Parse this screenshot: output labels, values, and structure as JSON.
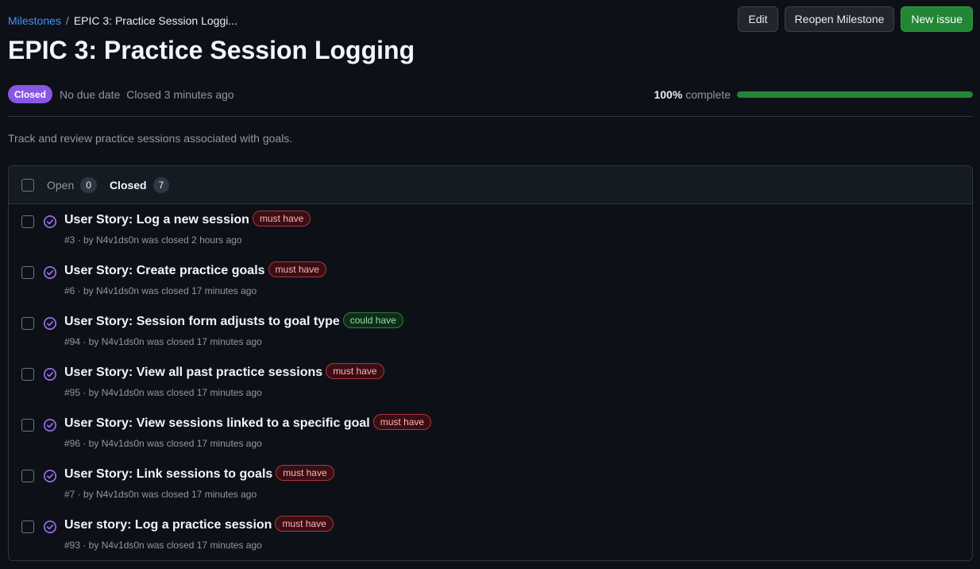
{
  "breadcrumb": {
    "root": "Milestones",
    "separator": "/",
    "current": "EPIC 3: Practice Session Loggi..."
  },
  "actions": {
    "edit": "Edit",
    "reopen": "Reopen Milestone",
    "new_issue": "New issue"
  },
  "milestone": {
    "title": "EPIC 3: Practice Session Logging",
    "state": "Closed",
    "due": "No due date",
    "closed_time": "Closed 3 minutes ago",
    "percent_label": "100%",
    "complete_word": "complete",
    "progress_fraction": 1.0,
    "description": "Track and review practice sessions associated with goals."
  },
  "filters": {
    "open_label": "Open",
    "open_count": "0",
    "closed_label": "Closed",
    "closed_count": "7"
  },
  "colors": {
    "accent_link": "#4493f8",
    "closed_purple": "#8957e5",
    "progress_green": "#238636"
  },
  "issues": [
    {
      "title": "User Story: Log a new session",
      "label": "must have",
      "label_type": "must",
      "meta": "#3 · by N4v1ds0n was closed 2 hours ago"
    },
    {
      "title": "User Story: Create practice goals",
      "label": "must have",
      "label_type": "must",
      "meta": "#6 · by N4v1ds0n was closed 17 minutes ago"
    },
    {
      "title": "User Story: Session form adjusts to goal type",
      "label": "could have",
      "label_type": "could",
      "meta": "#94 · by N4v1ds0n was closed 17 minutes ago"
    },
    {
      "title": "User Story: View all past practice sessions",
      "label": "must have",
      "label_type": "must",
      "meta": "#95 · by N4v1ds0n was closed 17 minutes ago"
    },
    {
      "title": "User Story: View sessions linked to a specific goal",
      "label": "must have",
      "label_type": "must",
      "meta": "#96 · by N4v1ds0n was closed 17 minutes ago"
    },
    {
      "title": "User Story: Link sessions to goals",
      "label": "must have",
      "label_type": "must",
      "meta": "#7 · by N4v1ds0n was closed 17 minutes ago"
    },
    {
      "title": "User story: Log a practice session",
      "label": "must have",
      "label_type": "must",
      "meta": "#93 · by N4v1ds0n was closed 17 minutes ago"
    }
  ]
}
